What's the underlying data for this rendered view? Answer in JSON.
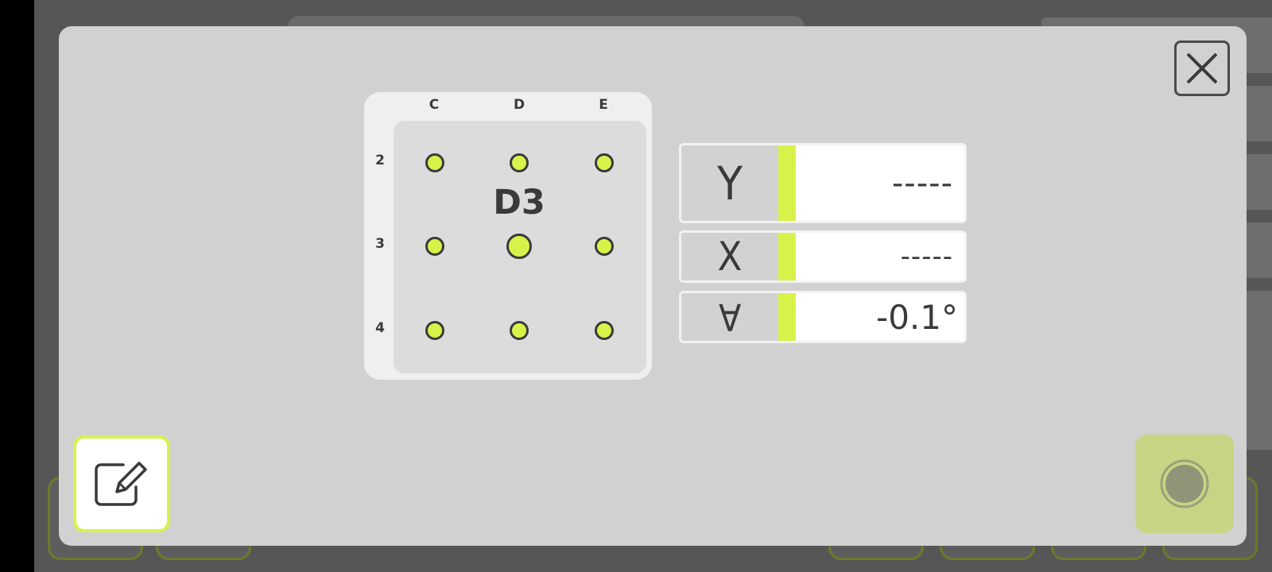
{
  "grid": {
    "columns": [
      "C",
      "D",
      "E"
    ],
    "rows": [
      "2",
      "3",
      "4"
    ],
    "selected": "D3"
  },
  "readouts": [
    {
      "axis": "Y",
      "value": "-----"
    },
    {
      "axis": "X",
      "value": "-----"
    },
    {
      "axis": "A",
      "value": "-0.1°"
    }
  ],
  "colors": {
    "accent": "#d9f24a",
    "modal": "#d1d1d1",
    "background": "#565656",
    "record_button": "#c6d583"
  },
  "icons": {
    "close": "close-icon",
    "edit": "edit-icon",
    "record": "record-icon"
  }
}
